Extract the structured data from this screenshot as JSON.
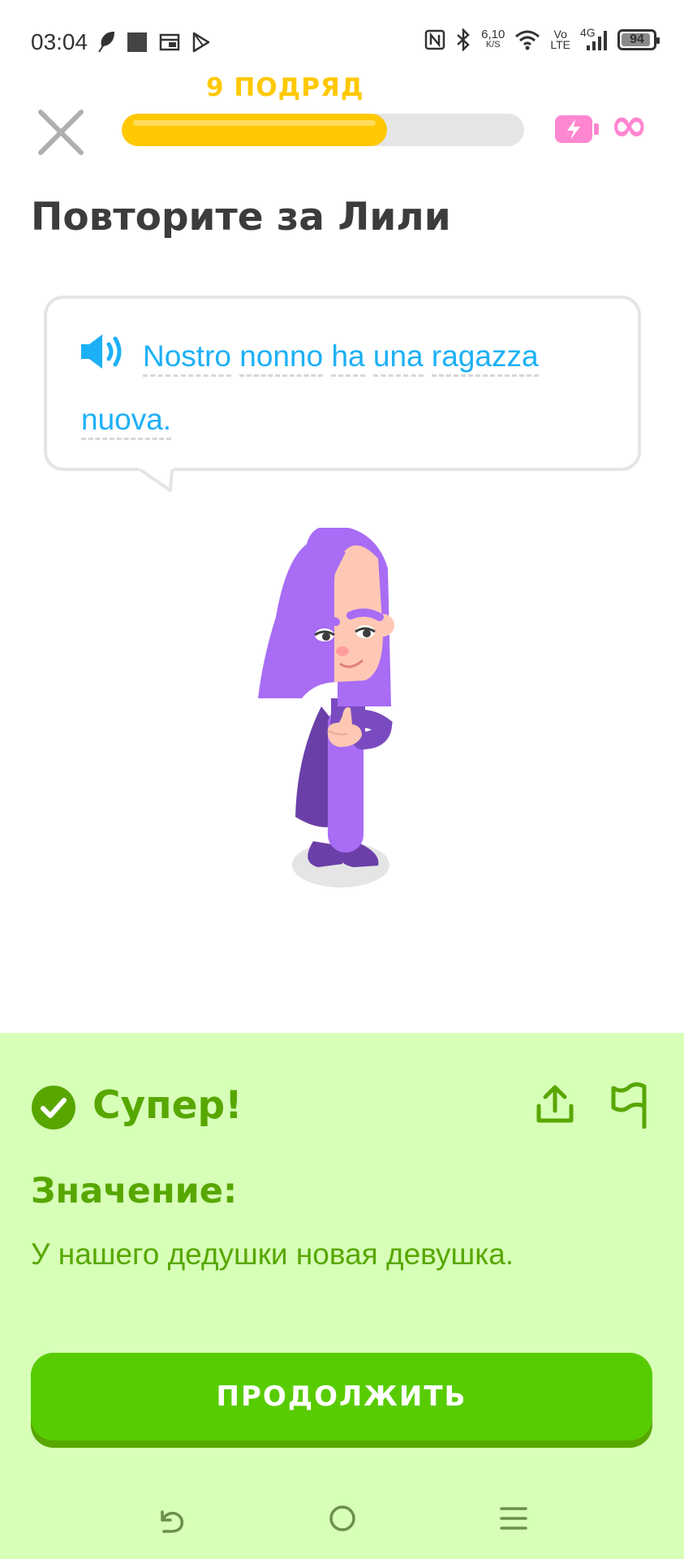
{
  "status_bar": {
    "time": "03:04",
    "net_speed_value": "6,10",
    "net_speed_unit": "K/S",
    "volte_top": "Vo",
    "volte_bottom": "LTE",
    "signal_label": "4G",
    "battery_level": "94",
    "battery_fraction": 0.94,
    "left_icons": [
      "feather-icon",
      "square-icon",
      "window-icon",
      "play-store-icon"
    ],
    "right_icons": [
      "nfc-icon",
      "bluetooth-icon",
      "wifi-icon",
      "signal-icon",
      "battery-icon"
    ]
  },
  "header": {
    "streak_label": "9 ПОДРЯД",
    "progress_fraction": 0.66,
    "hearts_symbol": "∞",
    "accent_color": "#ffc800",
    "energy_color": "#ff86d0"
  },
  "exercise": {
    "title": "Повторите за Лили",
    "sentence_words": [
      "Nostro",
      "nonno",
      "ha",
      "una",
      "ragazza",
      "nuova."
    ],
    "sentence_color": "#1cb0f6"
  },
  "feedback": {
    "result_label": "Супер!",
    "meaning_label": "Значение:",
    "meaning_text": "У нашего дедушки новая девушка.",
    "continue_label": "ПРОДОЛЖИТЬ",
    "panel_color": "#d7ffb8",
    "text_color": "#58a700",
    "button_color": "#58cc02"
  }
}
